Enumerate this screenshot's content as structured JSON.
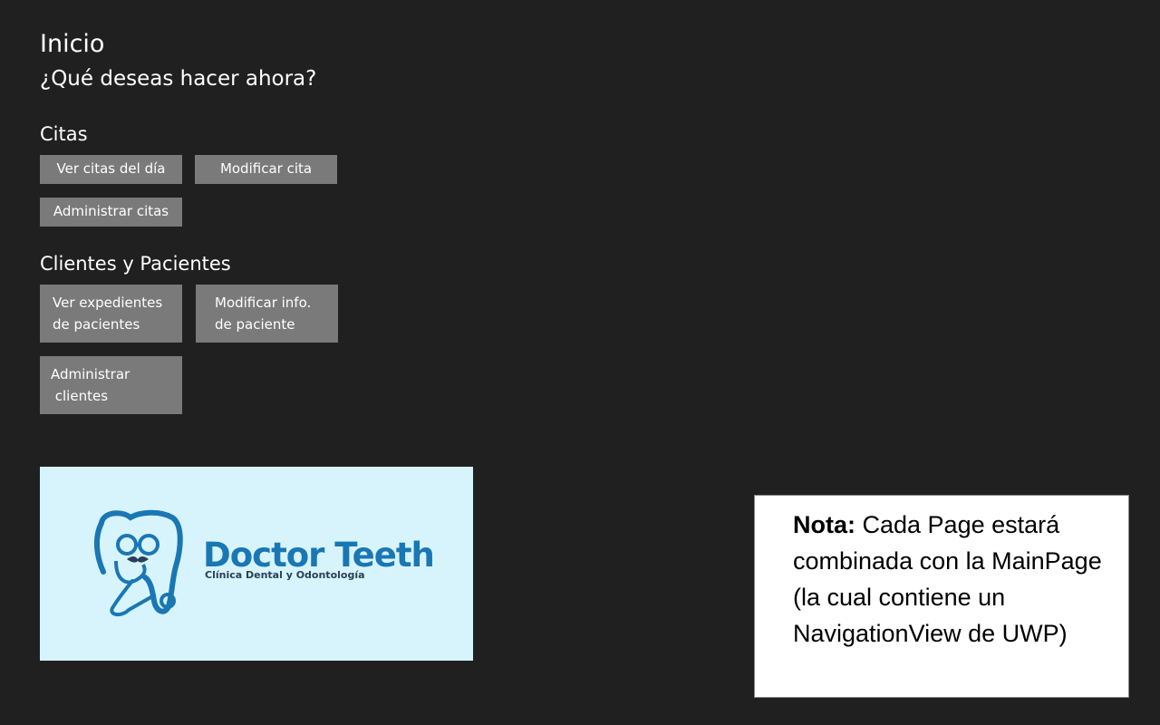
{
  "header": {
    "title": "Inicio",
    "subtitle": "¿Qué deseas hacer ahora?"
  },
  "citas": {
    "title": "Citas",
    "ver_label": "Ver citas del día",
    "modificar_label": "Modificar cita",
    "administrar_label": "Administrar citas"
  },
  "clientes": {
    "title": "Clientes y Pacientes",
    "ver_label": "Ver expedientes\nde pacientes",
    "modificar_label": "Modificar info.\nde paciente",
    "administrar_label": "Administrar\n clientes"
  },
  "logo": {
    "name": "Doctor Teeth",
    "tagline": "Clínica Dental y Odontología",
    "background": "#d7f4fc",
    "brand_color": "#1a77b4"
  },
  "note": {
    "label": "Nota:",
    "text": " Cada Page estará combinada con la MainPage (la cual contiene un NavigationView de UWP)"
  },
  "colors": {
    "background": "#202020",
    "button": "#7a7a7a"
  }
}
